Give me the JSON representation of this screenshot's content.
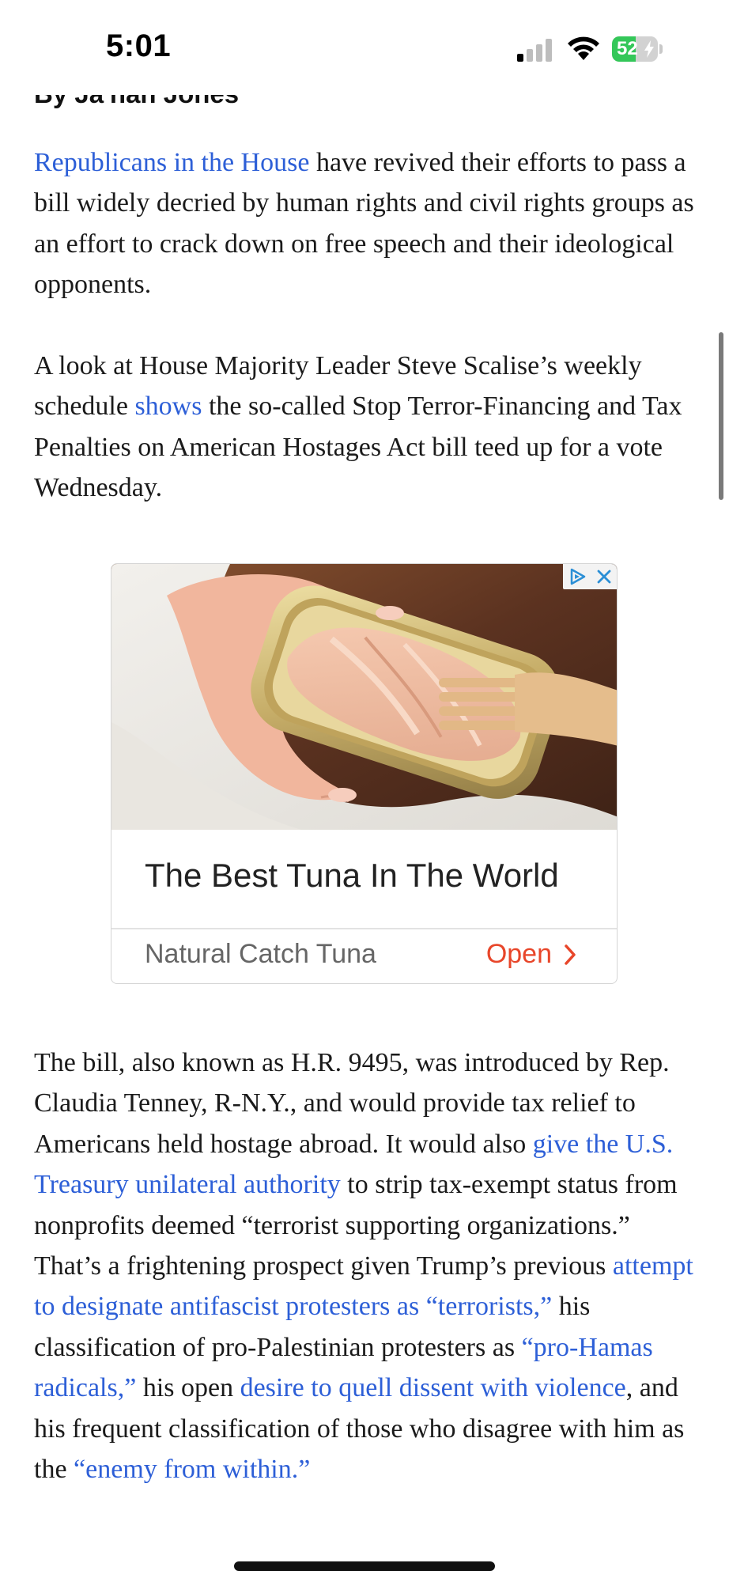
{
  "status_bar": {
    "time": "5:01",
    "battery_level": "52",
    "battery_fraction": 0.52,
    "signal_bars_active": 1,
    "signal_bars_total": 4,
    "icons": [
      "cellular-signal-icon",
      "wifi-icon",
      "battery-charging-icon"
    ]
  },
  "article": {
    "byline": "By Ja'han Jones",
    "paragraphs": [
      [
        {
          "text": "Republicans in the House",
          "link": true
        },
        {
          "text": " have revived their efforts to pass a bill widely decried by human rights and civil rights groups as an effort to crack down on free speech and their ideological opponents.",
          "link": false
        }
      ],
      [
        {
          "text": "A look at House Majority Leader Steve Scalise’s weekly schedule ",
          "link": false
        },
        {
          "text": "shows",
          "link": true
        },
        {
          "text": " the so-called Stop Terror-Financing and Tax Penalties on American Hostages Act bill teed up for a vote Wednesday.",
          "link": false
        }
      ],
      [
        {
          "text": "The bill, also known as H.R. 9495, was introduced by Rep. Claudia Tenney, R-N.Y., and would provide tax relief to Americans held hostage abroad. It would also ",
          "link": false
        },
        {
          "text": "give the U.S. Treasury unilateral authority",
          "link": true
        },
        {
          "text": " to strip tax-exempt status from nonprofits deemed “terrorist supporting organizations.” That’s a frightening prospect given Trump’s previous ",
          "link": false
        },
        {
          "text": "attempt to designate antifascist protesters as “terrorists,”",
          "link": true
        },
        {
          "text": " his classification of pro-Palestinian protesters as ",
          "link": false
        },
        {
          "text": "“pro-Hamas radicals,”",
          "link": true
        },
        {
          "text": " his open ",
          "link": false
        },
        {
          "text": "desire to quell dissent with violence",
          "link": true
        },
        {
          "text": ", and his frequent classification of those who disagree with him as the ",
          "link": false
        },
        {
          "text": "“enemy from within.”",
          "link": true
        }
      ]
    ]
  },
  "ad": {
    "headline": "The Best Tuna In The World",
    "advertiser": "Natural Catch Tuna",
    "cta_label": "Open",
    "image_icon": "tuna-can-photo",
    "choices_icons": [
      "adchoices-icon",
      "close-icon"
    ]
  },
  "colors": {
    "link": "#2d5fd7",
    "text": "#1a1a1a",
    "cta": "#e8462a",
    "battery": "#34c759"
  }
}
